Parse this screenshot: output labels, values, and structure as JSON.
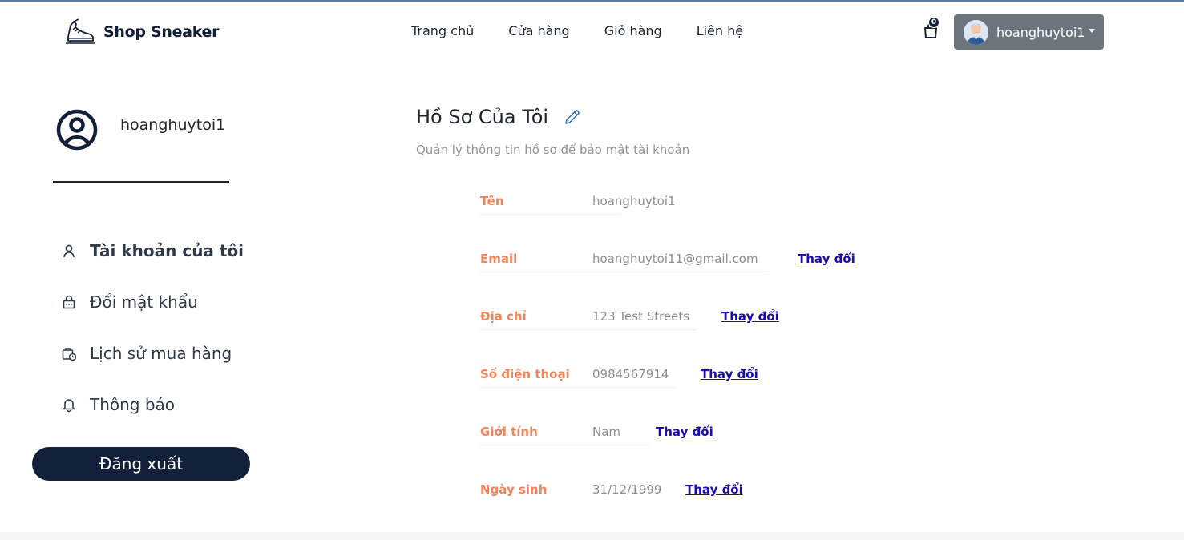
{
  "header": {
    "brand": "Shop Sneaker",
    "nav": [
      "Trang chủ",
      "Cửa hàng",
      "Giỏ hàng",
      "Liên hệ"
    ],
    "cart_count": "0",
    "username": "hoanghuytoi1"
  },
  "sidebar": {
    "username": "hoanghuytoi1",
    "items": [
      {
        "label": "Tài khoản của tôi",
        "icon": "user-icon"
      },
      {
        "label": "Đổi mật khẩu",
        "icon": "lock-icon"
      },
      {
        "label": "Lịch sử mua hàng",
        "icon": "order-history-icon"
      },
      {
        "label": "Thông báo",
        "icon": "bell-icon"
      }
    ],
    "logout": "Đăng xuất"
  },
  "main": {
    "title": "Hồ Sơ Của Tôi",
    "subtitle": "Quản lý thông tin hồ sơ để bảo mật tài khoản",
    "fields": [
      {
        "label": "Tên",
        "value": "hoanghuytoi1",
        "action": ""
      },
      {
        "label": "Email",
        "value": "hoanghuytoi11@gmail.com",
        "action": "Thay đổi"
      },
      {
        "label": "Địa chỉ",
        "value": "123 Test Streets",
        "action": "Thay đổi"
      },
      {
        "label": "Số điện thoại",
        "value": "0984567914",
        "action": "Thay đổi"
      },
      {
        "label": "Giới tính",
        "value": "Nam",
        "action": "Thay đổi"
      },
      {
        "label": "Ngày sinh",
        "value": "31/12/1999",
        "action": "Thay đổi"
      }
    ]
  },
  "colors": {
    "primary_dark": "#13203a",
    "label_orange": "#f0855c",
    "link_blue": "#1a0dab",
    "user_button_gray": "#6c757d"
  }
}
